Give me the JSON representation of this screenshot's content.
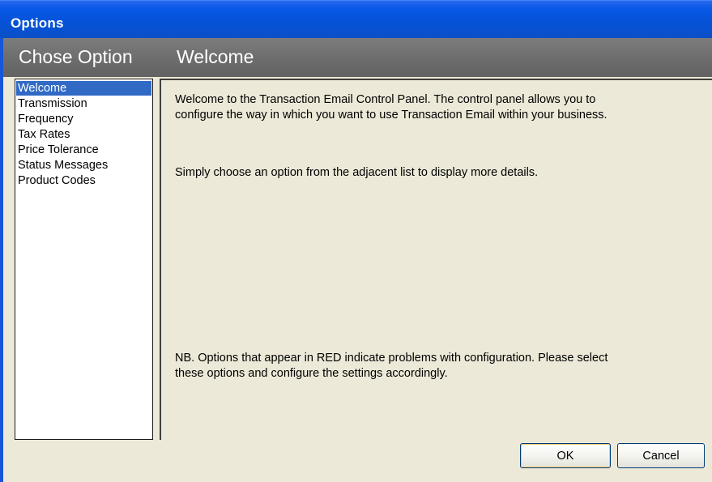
{
  "window": {
    "title": "Options"
  },
  "header": {
    "left_label": "Chose Option",
    "right_label": "Welcome"
  },
  "options_list": {
    "items": [
      {
        "label": "Welcome",
        "selected": true
      },
      {
        "label": "Transmission",
        "selected": false
      },
      {
        "label": "Frequency",
        "selected": false
      },
      {
        "label": "Tax Rates",
        "selected": false
      },
      {
        "label": "Price Tolerance",
        "selected": false
      },
      {
        "label": "Status Messages",
        "selected": false
      },
      {
        "label": "Product Codes",
        "selected": false
      }
    ]
  },
  "panel": {
    "intro_line1": "Welcome to the Transaction Email Control Panel. The control panel allows you to",
    "intro_line2": "configure the way in which you want to use Transaction Email within your business.",
    "instruction": "Simply choose an option from the adjacent list to display more details.",
    "note_line1": "NB. Options that appear in RED indicate problems with configuration. Please select",
    "note_line2": "these options and configure the settings accordingly."
  },
  "buttons": {
    "ok_label": "OK",
    "cancel_label": "Cancel"
  },
  "colors": {
    "selection": "#316ac5",
    "titlebar": "#0552d6",
    "header_band": "#6e6e6e",
    "dialog_bg": "#ece9d8"
  }
}
